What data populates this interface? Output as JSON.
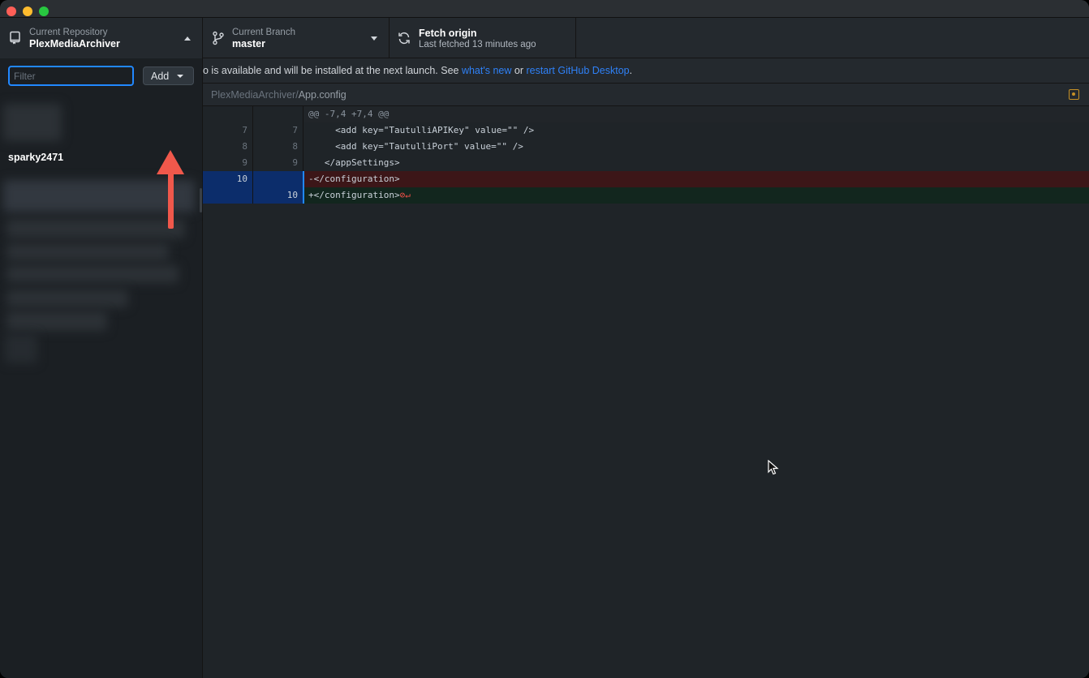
{
  "window": {
    "traffic_lights": [
      "close",
      "minimize",
      "zoom"
    ]
  },
  "toolbar": {
    "repo_label": "Current Repository",
    "repo_name": "PlexMediaArchiver",
    "branch_label": "Current Branch",
    "branch_name": "master",
    "fetch_title": "Fetch origin",
    "fetch_subtitle": "Last fetched 13 minutes ago"
  },
  "sidebar": {
    "filter_placeholder": "Filter",
    "add_label": "Add",
    "group_label": "sparky2471"
  },
  "banner": {
    "text_before": "o is available and will be installed at the next launch. See ",
    "link1": "what's new",
    "text_mid": " or ",
    "link2": "restart GitHub Desktop",
    "text_after": "."
  },
  "file": {
    "dir": "PlexMediaArchiver/",
    "name": "App.config"
  },
  "diff": {
    "hunk": "@@ -7,4 +7,4 @@",
    "lines": [
      {
        "old": "7",
        "new": "7",
        "text": "     <add key=\"TautulliAPIKey\" value=\"\" />"
      },
      {
        "old": "8",
        "new": "8",
        "text": "     <add key=\"TautulliPort\" value=\"\" />"
      },
      {
        "old": "9",
        "new": "9",
        "text": "   </appSettings>"
      },
      {
        "old": "10",
        "new": "",
        "text": "-</configuration>"
      },
      {
        "old": "",
        "new": "10",
        "text": "+</configuration>"
      }
    ],
    "no_newline_marker": "⊘↵"
  },
  "colors": {
    "accent": "#2188ff",
    "arrow": "#f0584b",
    "deleted_bg": "#3c1618",
    "added_bg": "#12261e"
  },
  "icons": [
    "repo-icon",
    "branch-icon",
    "sync-icon",
    "caret-up-icon",
    "caret-down-icon",
    "modified-file-icon",
    "mouse-cursor-icon"
  ]
}
